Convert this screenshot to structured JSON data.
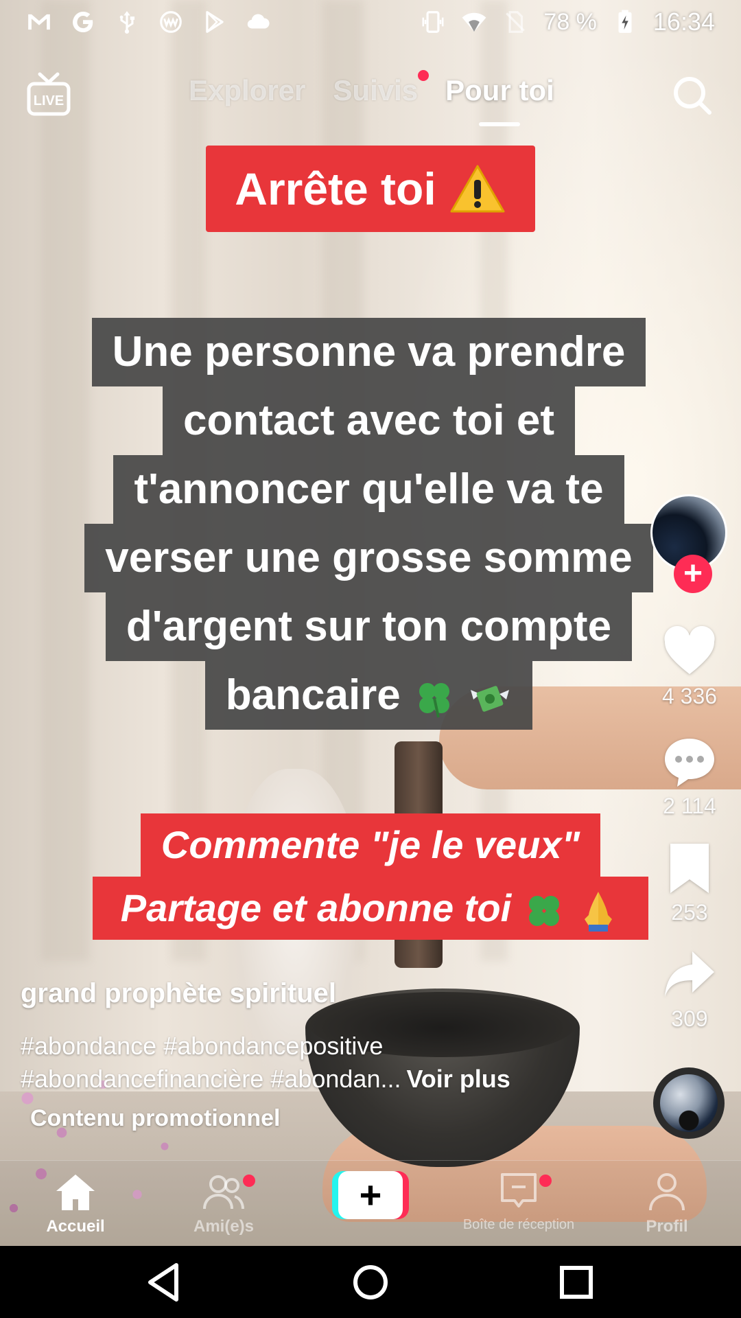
{
  "status_bar": {
    "icons_left": [
      "gmail-icon",
      "google-icon",
      "usb-icon",
      "vpn-icon",
      "play-store-icon",
      "cloud-icon"
    ],
    "icons_right": [
      "vibrate-icon",
      "wifi-icon",
      "no-sim-icon",
      "battery-charging-icon"
    ],
    "battery": "78 %",
    "time": "16:34"
  },
  "top_nav": {
    "live_label": "LIVE",
    "tabs": [
      {
        "label": "Explorer",
        "active": false
      },
      {
        "label": "Suivis",
        "active": false,
        "has_dot": true
      },
      {
        "label": "Pour toi",
        "active": true
      }
    ]
  },
  "video": {
    "banner_top": "Arrête toi",
    "caption_lines": [
      "Une personne va prendre",
      "contact avec toi et",
      "t'annoncer qu'elle va te",
      "verser une grosse somme",
      "d'argent sur ton compte",
      "bancaire"
    ],
    "banner_bottom_lines": [
      "Commente \"je le veux\"",
      "Partage et abonne toi"
    ]
  },
  "actions": {
    "likes": "4 336",
    "comments": "2 114",
    "saves": "253",
    "shares": "309"
  },
  "post": {
    "author": "grand prophète spirituel",
    "hashtags_line1": "#abondance #abondancepositive",
    "hashtags_line2": "#abondancefinancière #abondan...",
    "more": "Voir plus",
    "promo": "Contenu promotionnel"
  },
  "bottom_tabs": [
    {
      "label": "Accueil",
      "active": true
    },
    {
      "label": "Ami(e)s",
      "active": false,
      "has_dot": true
    },
    {
      "label": "Boîte de réception",
      "active": false,
      "has_dot": true
    },
    {
      "label": "Profil",
      "active": false
    }
  ],
  "colors": {
    "accent_red": "#fe2c55",
    "banner_red": "#e8363a",
    "accent_cyan": "#25f4ee"
  }
}
